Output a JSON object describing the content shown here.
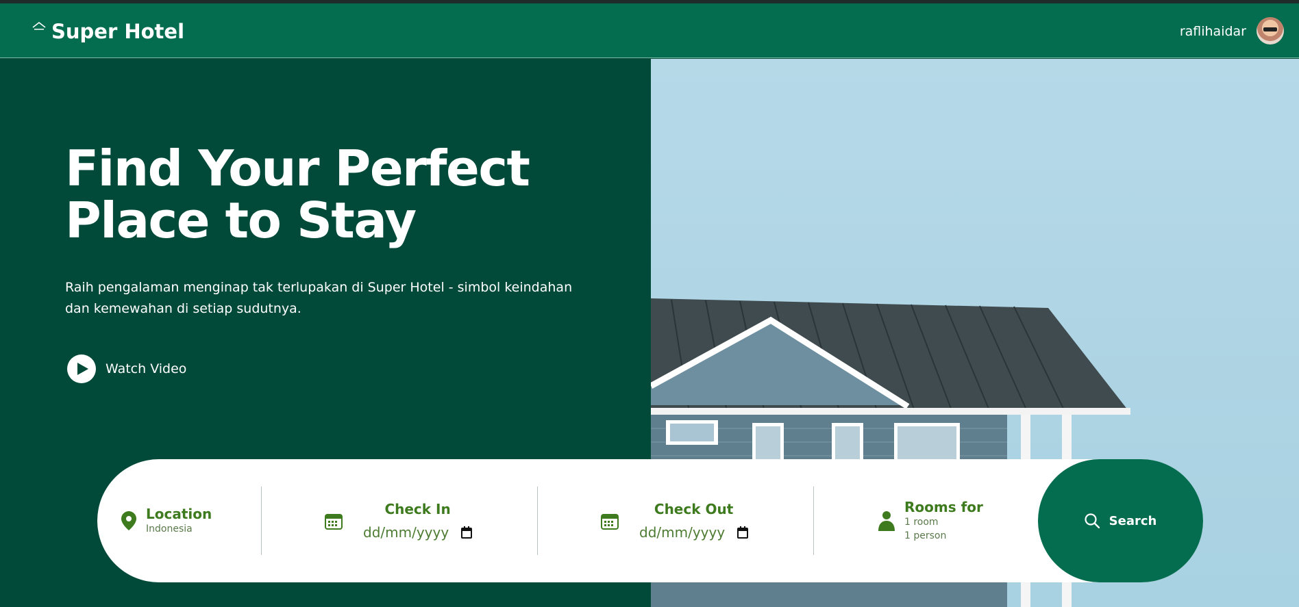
{
  "header": {
    "brand": "Super Hotel",
    "username": "raflihaidar"
  },
  "hero": {
    "title_line1": "Find Your Perfect",
    "title_line2": "Place to Stay",
    "subtitle": "Raih pengalaman menginap tak terlupakan di Super Hotel - simbol keindahan dan kemewahan di setiap sudutnya.",
    "watch_label": "Watch Video"
  },
  "search": {
    "location": {
      "title": "Location",
      "value": "Indonesia"
    },
    "check_in": {
      "title": "Check In",
      "placeholder": "dd/mm/yyyy"
    },
    "check_out": {
      "title": "Check Out",
      "placeholder": "dd/mm/yyyy"
    },
    "rooms": {
      "title": "Rooms for",
      "rooms": "1 room",
      "persons": "1 person"
    },
    "button_label": "Search"
  },
  "colors": {
    "primary": "#056d4f",
    "dark_green": "#014a3a",
    "accent_text": "#3e7a1e"
  }
}
